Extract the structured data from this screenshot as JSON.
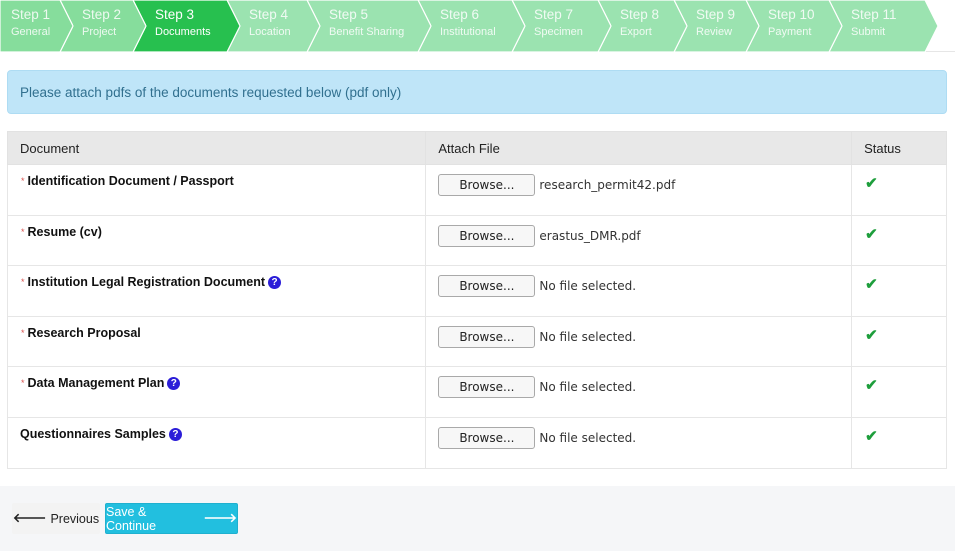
{
  "wizard": {
    "steps": [
      {
        "number": "Step 1",
        "label": "General"
      },
      {
        "number": "Step 2",
        "label": "Project"
      },
      {
        "number": "Step 3",
        "label": "Documents"
      },
      {
        "number": "Step 4",
        "label": "Location"
      },
      {
        "number": "Step 5",
        "label": "Benefit Sharing"
      },
      {
        "number": "Step 6",
        "label": "Institutional"
      },
      {
        "number": "Step 7",
        "label": "Specimen"
      },
      {
        "number": "Step 8",
        "label": "Export"
      },
      {
        "number": "Step 9",
        "label": "Review"
      },
      {
        "number": "Step 10",
        "label": "Payment"
      },
      {
        "number": "Step 11",
        "label": "Submit"
      }
    ],
    "active_step": 3,
    "colors": {
      "completed": "#86dd9c",
      "active": "#27c04f",
      "pending": "#9be3b0"
    }
  },
  "alert": {
    "text": "Please attach pdfs of the documents requested below (pdf only)"
  },
  "table": {
    "headers": {
      "document": "Document",
      "attach": "Attach File",
      "status": "Status"
    },
    "rows": [
      {
        "required": true,
        "name": "Identification Document / Passport",
        "help": false,
        "button": "Browse...",
        "file": "research_permit42.pdf",
        "status": "complete"
      },
      {
        "required": true,
        "name": "Resume (cv)",
        "help": false,
        "button": "Browse...",
        "file": "erastus_DMR.pdf",
        "status": "complete"
      },
      {
        "required": true,
        "name": "Institution Legal Registration Document",
        "help": true,
        "button": "Browse...",
        "file": "No file selected.",
        "status": "complete"
      },
      {
        "required": true,
        "name": "Research Proposal",
        "help": false,
        "button": "Browse...",
        "file": "No file selected.",
        "status": "complete"
      },
      {
        "required": true,
        "name": "Data Management Plan",
        "help": true,
        "button": "Browse...",
        "file": "No file selected.",
        "status": "complete"
      },
      {
        "required": false,
        "name": "Questionnaires Samples",
        "help": true,
        "button": "Browse...",
        "file": "No file selected.",
        "status": "complete"
      }
    ],
    "required_marker": "*",
    "help_glyph": "?",
    "check_glyph": "✔"
  },
  "footer": {
    "previous_label": "Previous",
    "save_label": "Save & Continue",
    "previous_icon": "arrow-left-icon",
    "save_icon": "arrow-right-icon"
  }
}
